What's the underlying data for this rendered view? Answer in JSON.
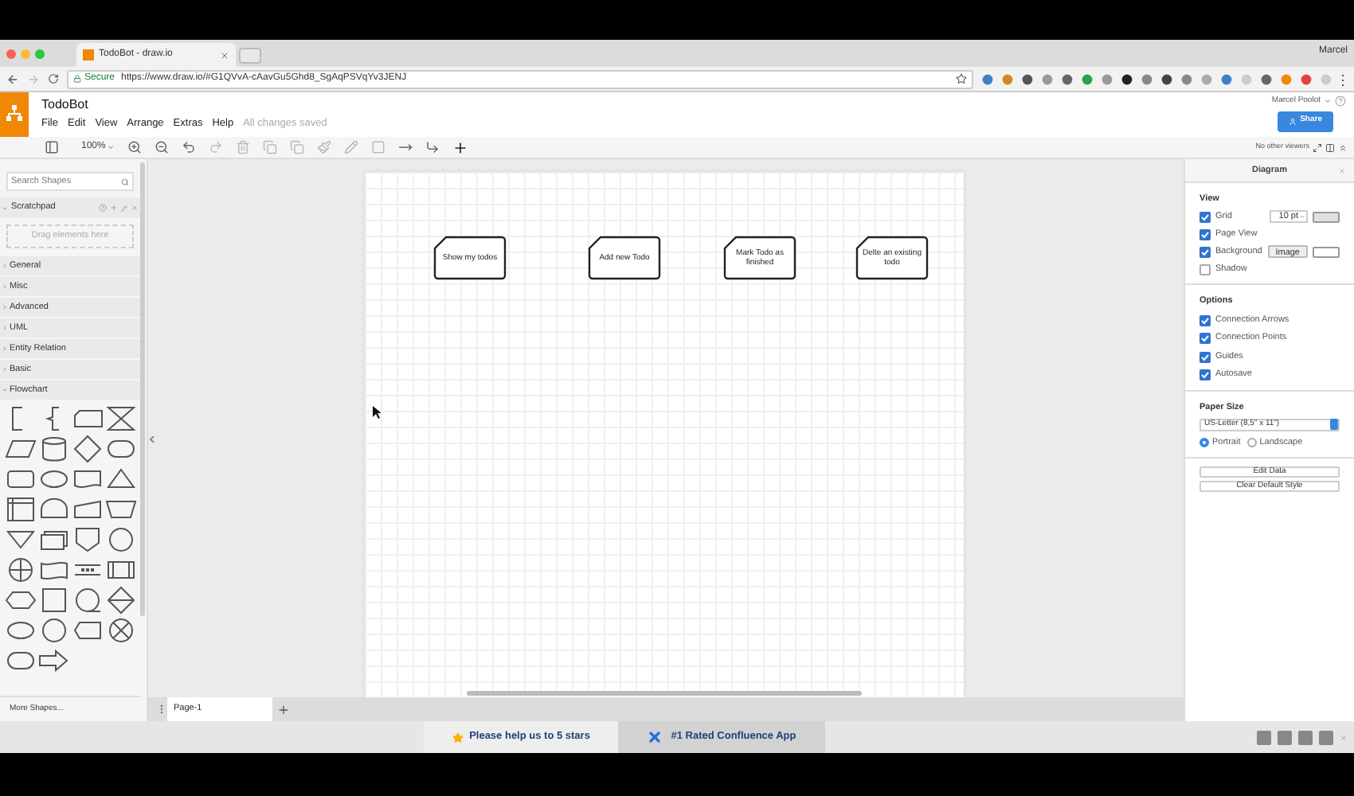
{
  "browser": {
    "tab_title": "TodoBot - draw.io",
    "profile": "Marcel",
    "secure_label": "Secure",
    "url": "https://www.draw.io/#G1QVvA-cAavGu5Ghd8_SgAqPSVqYv3JENJ"
  },
  "app": {
    "title": "TodoBot",
    "menus": [
      "File",
      "Edit",
      "View",
      "Arrange",
      "Extras",
      "Help"
    ],
    "save_status": "All changes saved",
    "user": "Marcel Poolot",
    "share": "Share",
    "zoom": "100%",
    "viewers": "No other viewers"
  },
  "sidebar": {
    "search": {
      "placeholder": "Search Shapes"
    },
    "scratchpad": {
      "title": "Scratchpad",
      "drop_hint": "Drag elements here"
    },
    "sections": [
      {
        "label": "General",
        "expanded": false
      },
      {
        "label": "Misc",
        "expanded": false
      },
      {
        "label": "Advanced",
        "expanded": false
      },
      {
        "label": "UML",
        "expanded": false
      },
      {
        "label": "Entity Relation",
        "expanded": false
      },
      {
        "label": "Basic",
        "expanded": false
      },
      {
        "label": "Flowchart",
        "expanded": true
      }
    ],
    "more_shapes": "More Shapes..."
  },
  "canvas": {
    "nodes": [
      {
        "text": "Show my todos"
      },
      {
        "text": "Add new Todo"
      },
      {
        "text": "Mark Todo as finished"
      },
      {
        "text": "Delte an existing todo"
      }
    ],
    "pages": [
      {
        "label": "Page-1",
        "selected": true
      }
    ]
  },
  "format_panel": {
    "title": "Diagram",
    "view_heading": "View",
    "view_options": [
      {
        "label": "Grid",
        "checked": true,
        "kind": "grid"
      },
      {
        "label": "Page View",
        "checked": true,
        "kind": "plain"
      },
      {
        "label": "Background",
        "checked": true,
        "kind": "background"
      },
      {
        "label": "Shadow",
        "checked": false,
        "kind": "plain"
      }
    ],
    "grid_size": "10 pt",
    "image_button": "Image",
    "options_heading": "Options",
    "options": [
      {
        "label": "Connection Arrows",
        "checked": true
      },
      {
        "label": "Connection Points",
        "checked": true
      },
      {
        "label": "Guides",
        "checked": true
      },
      {
        "label": "Autosave",
        "checked": true
      }
    ],
    "paper_heading": "Paper Size",
    "paper_size": "US-Letter (8,5\" x 11\")",
    "orientation": [
      {
        "label": "Portrait",
        "selected": true
      },
      {
        "label": "Landscape",
        "selected": false
      }
    ],
    "buttons": [
      "Edit Data",
      "Clear Default Style"
    ]
  },
  "footer": {
    "rate": "Please help us to 5 stars",
    "promo": "#1 Rated Confluence App"
  }
}
